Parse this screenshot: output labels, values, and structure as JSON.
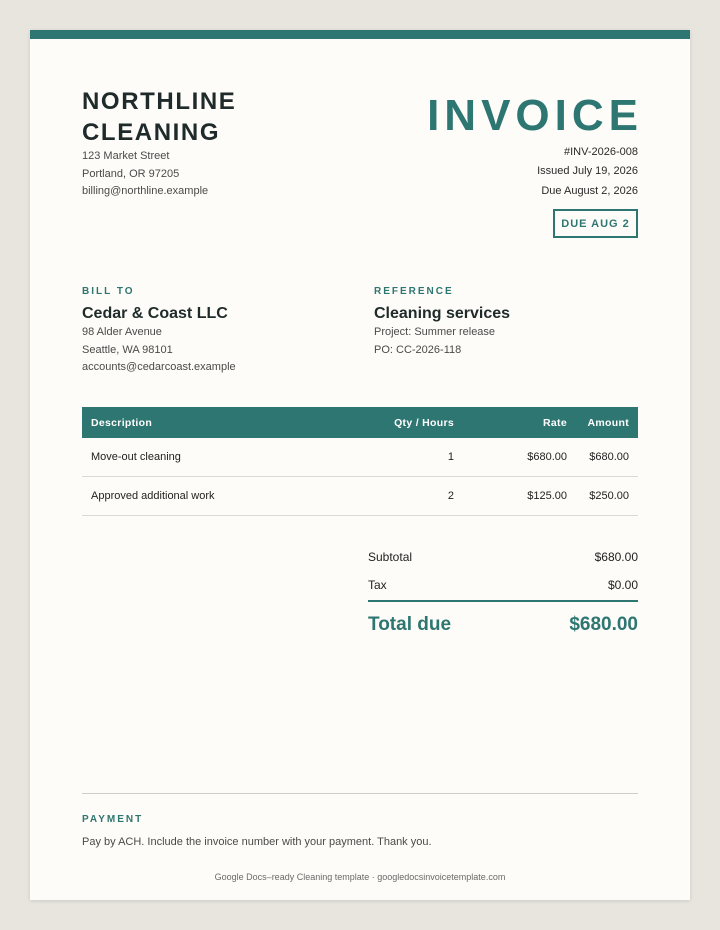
{
  "company": {
    "name": "NORTHLINE CLEANING",
    "address_line1": "123 Market Street",
    "address_line2": "Portland, OR 97205",
    "email": "billing@northline.example"
  },
  "invoice": {
    "title": "INVOICE",
    "number": "#INV-2026-008",
    "issued": "Issued July 19, 2026",
    "due": "Due August 2, 2026",
    "due_badge": "DUE AUG 2"
  },
  "bill_to": {
    "label": "BILL TO",
    "name": "Cedar & Coast LLC",
    "address_line1": "98 Alder Avenue",
    "address_line2": "Seattle, WA 98101",
    "email": "accounts@cedarcoast.example"
  },
  "reference": {
    "label": "REFERENCE",
    "title": "Cleaning services",
    "project": "Project: Summer release",
    "po": "PO: CC-2026-118"
  },
  "table": {
    "headers": {
      "description": "Description",
      "qty": "Qty / Hours",
      "rate": "Rate",
      "amount": "Amount"
    },
    "rows": [
      {
        "description": "Move-out cleaning",
        "qty": "1",
        "rate": "$680.00",
        "amount": "$680.00"
      },
      {
        "description": "Approved additional work",
        "qty": "2",
        "rate": "$125.00",
        "amount": "$250.00"
      }
    ]
  },
  "totals": {
    "subtotal_label": "Subtotal",
    "subtotal_value": "$680.00",
    "tax_label": "Tax",
    "tax_value": "$0.00",
    "total_label": "Total due",
    "total_value": "$680.00"
  },
  "payment": {
    "label": "PAYMENT",
    "text": "Pay by ACH. Include the invoice number with your payment. Thank you."
  },
  "footer": {
    "credit": "Google Docs–ready Cleaning template · googledocsinvoicetemplate.com"
  },
  "colors": {
    "accent": "#2e7671",
    "page": "#fdfcf8",
    "background": "#e8e5df"
  }
}
